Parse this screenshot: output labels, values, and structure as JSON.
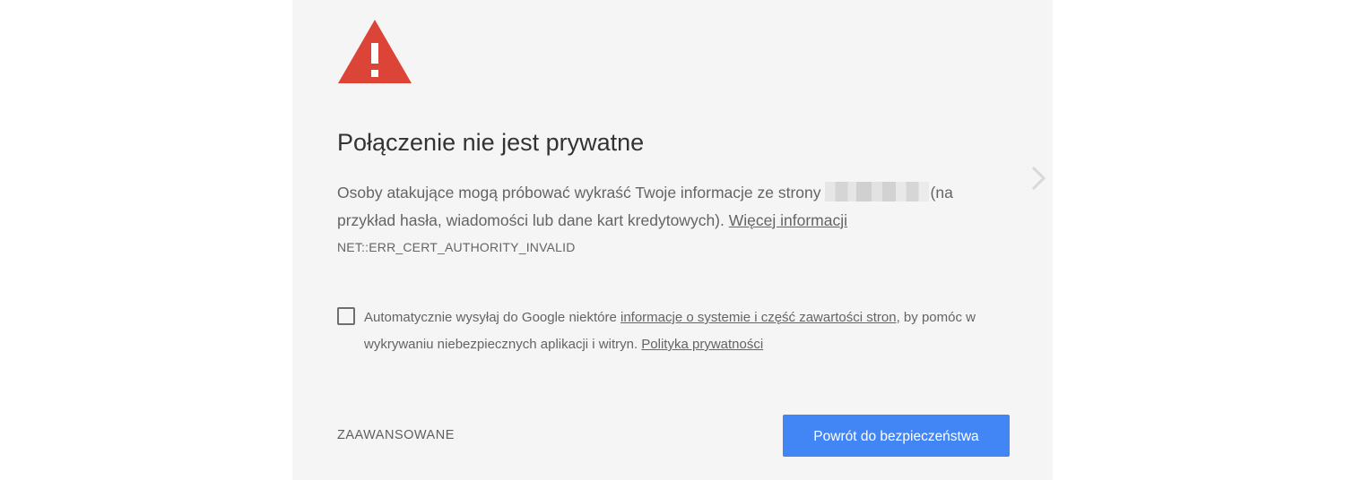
{
  "page": {
    "title": "Połączenie nie jest prywatne",
    "description_before": "Osoby atakujące mogą próbować wykraść Twoje informacje ze strony",
    "description_after": "(na przykład hasła, wiadomości lub dane kart kredytowych).",
    "learn_more_link": "Więcej informacji",
    "error_code": "NET::ERR_CERT_AUTHORITY_INVALID"
  },
  "report_option": {
    "checked": false,
    "text_before": "Automatycznie wysyłaj do Google niektóre",
    "info_link": "informacje o systemie i część zawartości stron",
    "text_after": ", by pomóc w wykrywaniu niebezpiecznych aplikacji i witryn.",
    "privacy_link": "Polityka prywatności"
  },
  "actions": {
    "advanced_label": "ZAAWANSOWANE",
    "back_label": "Powrót do bezpieczeństwa"
  },
  "colors": {
    "warning_red": "#db4437",
    "primary_blue": "#4285f4",
    "panel_background": "#f5f5f5"
  },
  "icons": {
    "warning": "warning-triangle-icon",
    "next": "chevron-right-icon"
  }
}
